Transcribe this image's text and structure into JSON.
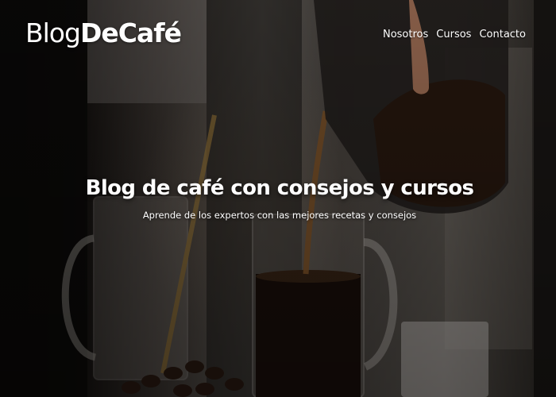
{
  "brand": {
    "prefix": "Blog",
    "bold": "DeCafé"
  },
  "nav": {
    "items": [
      {
        "label": "Nosotros"
      },
      {
        "label": "Cursos"
      },
      {
        "label": "Contacto"
      }
    ]
  },
  "hero": {
    "title": "Blog de café con consejos y cursos",
    "subtitle": "Aprende de los expertos con las mejores recetas y consejos",
    "background_image": "coffee-pouring-photo"
  },
  "colors": {
    "text": "#ffffff",
    "overlay": "#000000"
  }
}
